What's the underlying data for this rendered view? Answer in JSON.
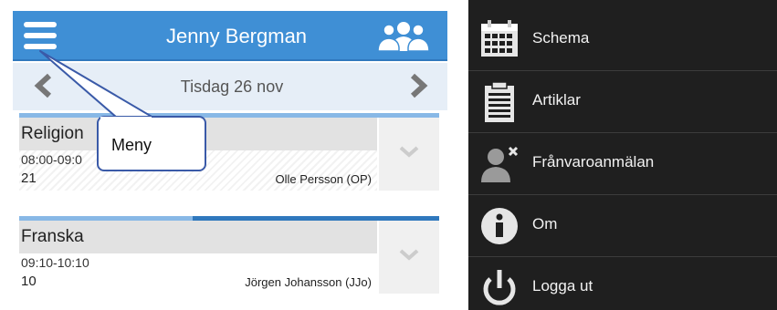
{
  "app": {
    "title": "Jenny Bergman",
    "date_label": "Tisdag 26 nov"
  },
  "lessons": [
    {
      "subject": "Religion",
      "time": "08:00-09:0",
      "room": "21",
      "teacher": "Olle Persson (OP)"
    },
    {
      "subject": "Franska",
      "time": "09:10-10:10",
      "room": "10",
      "teacher": "Jörgen Johansson (JJo)"
    }
  ],
  "callout": {
    "text": "Meny"
  },
  "menu": {
    "items": [
      {
        "label": "Schema",
        "icon": "calendar-icon"
      },
      {
        "label": "Artiklar",
        "icon": "clipboard-icon"
      },
      {
        "label": "Frånvaroanmälan",
        "icon": "person-absence-icon"
      },
      {
        "label": "Om",
        "icon": "info-icon"
      },
      {
        "label": "Logga ut",
        "icon": "power-icon"
      }
    ]
  },
  "colors": {
    "appbar": "#3f8fd5",
    "menu_bg": "#1f1f1f",
    "callout_border": "#3a5aa8"
  }
}
